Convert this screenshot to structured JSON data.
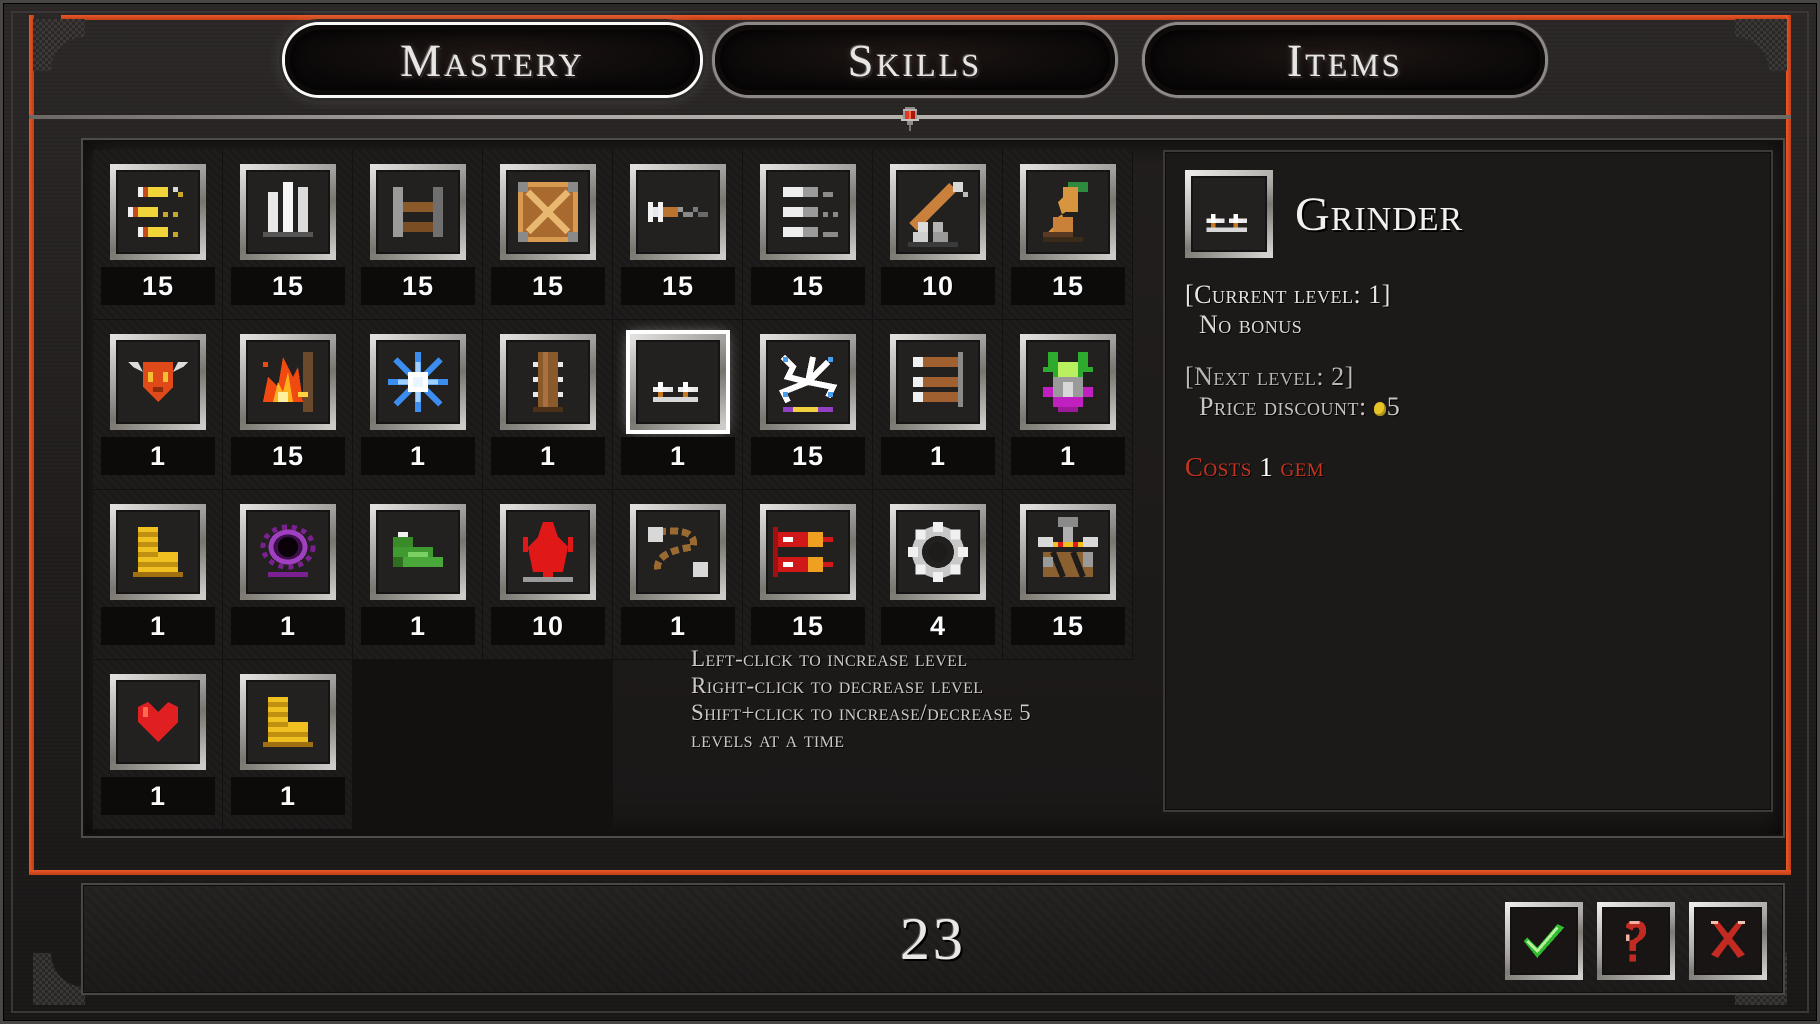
{
  "window": {
    "title": "Mastery Upgrade Screen"
  },
  "tabs": [
    {
      "label": "Mastery",
      "active": true
    },
    {
      "label": "Skills",
      "active": false
    },
    {
      "label": "Items",
      "active": false
    }
  ],
  "grid": {
    "columns": 8,
    "rows": 4,
    "items": [
      {
        "name": "yellow-rods-icon",
        "level": "15",
        "selected": false
      },
      {
        "name": "white-pillars-icon",
        "level": "15",
        "selected": false
      },
      {
        "name": "wooden-rack-icon",
        "level": "15",
        "selected": false
      },
      {
        "name": "crate-icon",
        "level": "15",
        "selected": false
      },
      {
        "name": "arrow-flight-icon",
        "level": "15",
        "selected": false
      },
      {
        "name": "silver-rods-icon",
        "level": "15",
        "selected": false
      },
      {
        "name": "pickaxe-rubble-icon",
        "level": "10",
        "selected": false
      },
      {
        "name": "leather-boot-icon",
        "level": "15",
        "selected": false
      },
      {
        "name": "demon-skull-icon",
        "level": "1",
        "selected": false
      },
      {
        "name": "fire-burst-icon",
        "level": "15",
        "selected": false
      },
      {
        "name": "snowflake-icon",
        "level": "1",
        "selected": false
      },
      {
        "name": "wood-log-icon",
        "level": "1",
        "selected": false
      },
      {
        "name": "grinder-icon",
        "level": "1",
        "selected": true
      },
      {
        "name": "lightning-icon",
        "level": "15",
        "selected": false
      },
      {
        "name": "copper-bars-icon",
        "level": "1",
        "selected": false
      },
      {
        "name": "green-bug-icon",
        "level": "1",
        "selected": false
      },
      {
        "name": "gold-coins-icon",
        "level": "1",
        "selected": false
      },
      {
        "name": "void-orb-icon",
        "level": "1",
        "selected": false
      },
      {
        "name": "frog-icon",
        "level": "1",
        "selected": false
      },
      {
        "name": "red-flame-figure-icon",
        "level": "10",
        "selected": false
      },
      {
        "name": "chain-icon",
        "level": "1",
        "selected": false
      },
      {
        "name": "rockets-icon",
        "level": "15",
        "selected": false
      },
      {
        "name": "gear-ring-icon",
        "level": "4",
        "selected": false
      },
      {
        "name": "anvil-hammer-icon",
        "level": "15",
        "selected": false
      },
      {
        "name": "heart-icon",
        "level": "1",
        "selected": false
      },
      {
        "name": "gold-stack-icon",
        "level": "1",
        "selected": false
      },
      {
        "name": "empty-slot",
        "level": "",
        "selected": false,
        "empty": true
      },
      {
        "name": "empty-slot",
        "level": "",
        "selected": false,
        "empty": true
      }
    ]
  },
  "instructions": {
    "line1": "Left-click to increase level",
    "line2": "Right-click to decrease level",
    "line3": "Shift+click to increase/decrease 5",
    "line4": "levels at a time"
  },
  "detail": {
    "icon_name": "grinder-icon",
    "title": "Grinder",
    "current_level_label": "[Current level: 1]",
    "current_bonus": "No bonus",
    "next_level_label": "[Next level: 2]",
    "next_bonus_prefix": "Price discount: ",
    "next_bonus_value": "5",
    "cost_prefix": "Costs ",
    "cost_amount": "1",
    "cost_suffix": " gem"
  },
  "bottom": {
    "counter": "23",
    "buttons": [
      {
        "name": "confirm-button",
        "glyph": "check",
        "color": "#2fbd2f"
      },
      {
        "name": "help-button",
        "glyph": "question",
        "color": "#c32a22"
      },
      {
        "name": "cancel-button",
        "glyph": "cross",
        "color": "#c32a22"
      }
    ]
  },
  "colors": {
    "accent_orange": "#e8582a",
    "frame_silver": "#b5b1ad",
    "cost_red": "#c6341f",
    "gem_yellow": "#e6c428",
    "panel_bg": "#1c1a19"
  }
}
